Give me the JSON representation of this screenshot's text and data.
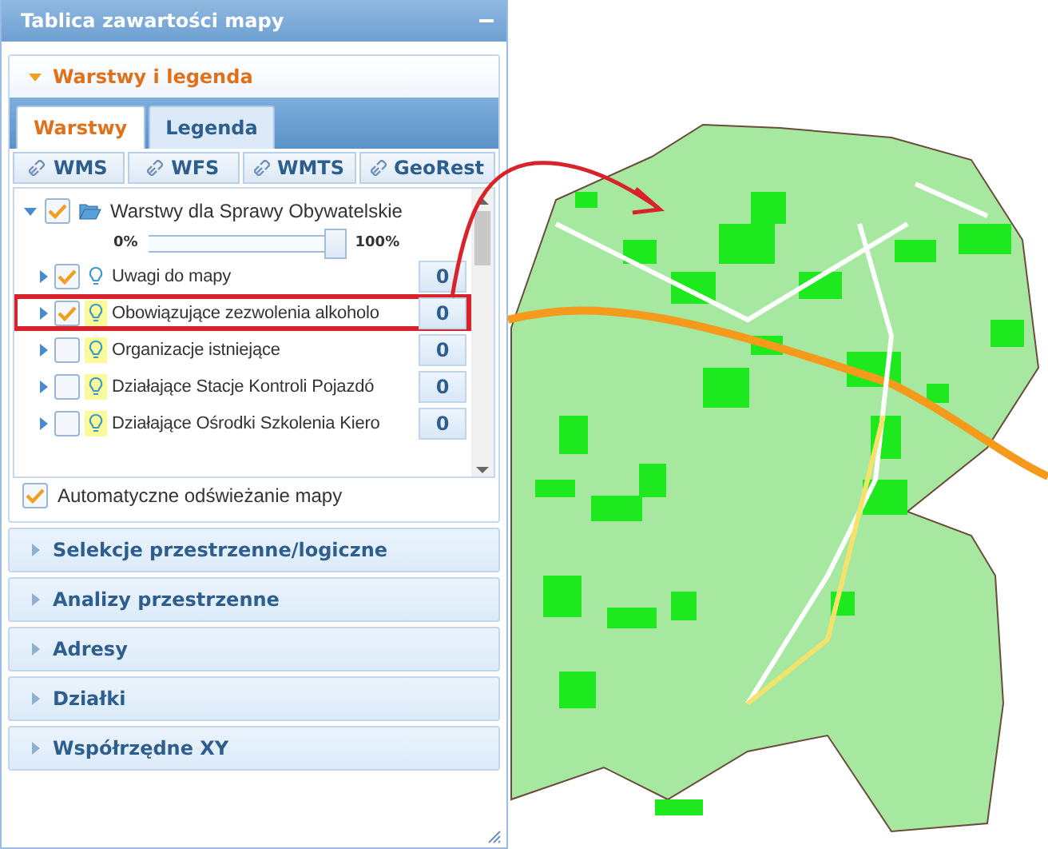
{
  "panel": {
    "title": "Tablica zawartości mapy"
  },
  "layers_section": {
    "title": "Warstwy i legenda",
    "expanded": true,
    "tabs": [
      {
        "label": "Warstwy",
        "selected": true
      },
      {
        "label": "Legenda",
        "selected": false
      }
    ],
    "services": [
      "WMS",
      "WFS",
      "WMTS",
      "GeoRest"
    ],
    "group": {
      "name": "Warstwy dla Sprawy Obywatelskie",
      "checked": true,
      "expanded": true,
      "opacity_min": "0%",
      "opacity_max": "100%",
      "level": 0.95,
      "layers": [
        {
          "name": "Uwagi do mapy",
          "checked": true,
          "lit": false,
          "highlighted": false,
          "count": "0"
        },
        {
          "name": "Obowiązujące zezwolenia alkoholo",
          "checked": true,
          "lit": true,
          "highlighted": true,
          "count": "0"
        },
        {
          "name": "Organizacje istniejące",
          "checked": false,
          "lit": true,
          "highlighted": false,
          "count": "0"
        },
        {
          "name": "Działające Stacje Kontroli Pojazdó",
          "checked": false,
          "lit": true,
          "highlighted": false,
          "count": "0"
        },
        {
          "name": "Działające Ośrodki Szkolenia Kiero",
          "checked": false,
          "lit": true,
          "highlighted": false,
          "count": "0"
        }
      ]
    },
    "auto_refresh": {
      "label": "Automatyczne odświeżanie mapy",
      "checked": true
    }
  },
  "sections": [
    {
      "title": "Selekcje przestrzenne/logiczne",
      "expanded": false
    },
    {
      "title": "Analizy przestrzenne",
      "expanded": false
    },
    {
      "title": "Adresy",
      "expanded": false
    },
    {
      "title": "Działki",
      "expanded": false
    },
    {
      "title": "Współrzędne XY",
      "expanded": false
    }
  ]
}
